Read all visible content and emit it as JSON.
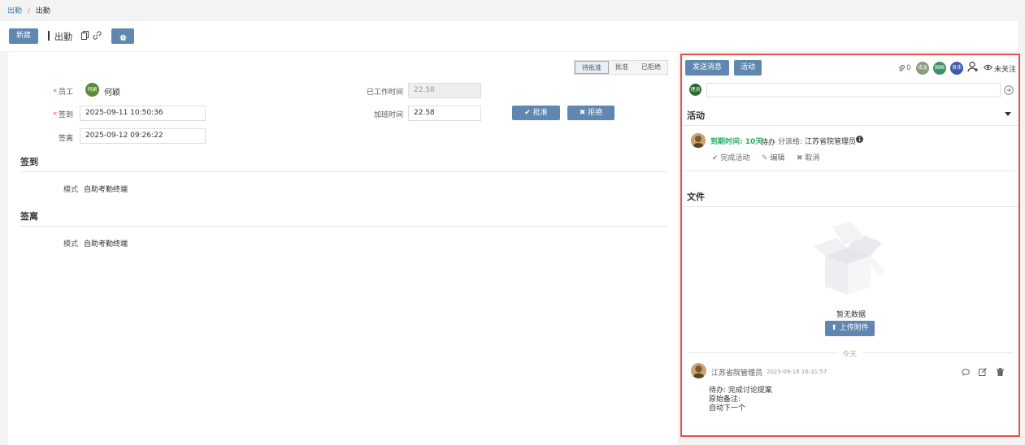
{
  "breadcrumb": {
    "root": "出勤",
    "sep": "/",
    "current": "出勤"
  },
  "toolbar": {
    "new_label": "新建",
    "title": "出勤"
  },
  "status": {
    "steps": [
      "待批准",
      "批准",
      "已拒绝"
    ]
  },
  "form": {
    "employee_label": "员工",
    "employee_avatar": "何颖",
    "employee_name": "何颖",
    "checkin_label": "签到",
    "checkin_value": "2025-09-11 10:50:36",
    "checkout_label": "签离",
    "checkout_value": "2025-09-12 09:26:22",
    "worked_label": "已工作时间",
    "worked_value": "22.58",
    "overtime_label": "加班时间",
    "overtime_value": "22.58",
    "approve_label": "批准",
    "reject_label": "拒绝"
  },
  "sections": {
    "checkin_title": "签到",
    "checkin_mode_label": "模式",
    "checkin_mode_value": "自助考勤终端",
    "checkout_title": "签离",
    "checkout_mode_label": "模式",
    "checkout_mode_value": "自助考勤终端"
  },
  "sidebar": {
    "send_message_label": "发送消息",
    "activity_tab_label": "活动",
    "attachment_count": "0",
    "followers": [
      "成龙",
      "国画",
      "良伟"
    ],
    "unfollow_label": "未关注",
    "composer_avatar": "理员",
    "activity_title": "活动",
    "activity": {
      "due_text": "到期时间: 10天",
      "state": "待办",
      "assign_prefix": "分派给:",
      "assignee": "江苏省院管理员",
      "complete_label": "完成活动",
      "edit_label": "编辑",
      "cancel_label": "取消"
    },
    "files_title": "文件",
    "empty_text": "暂无数据",
    "upload_label": "上传附件",
    "today_label": "今天",
    "message": {
      "author": "江苏省院管理员",
      "time": "2025-09-18 16:31:57",
      "line1": "待办: 完成讨论提案",
      "line2": "原始备注:",
      "line3": "自动下一个"
    }
  },
  "colors": {
    "primary": "#5f87b0",
    "highlight_border": "#e7504e",
    "due_green": "#27ae60",
    "required": "#e74c3c"
  }
}
